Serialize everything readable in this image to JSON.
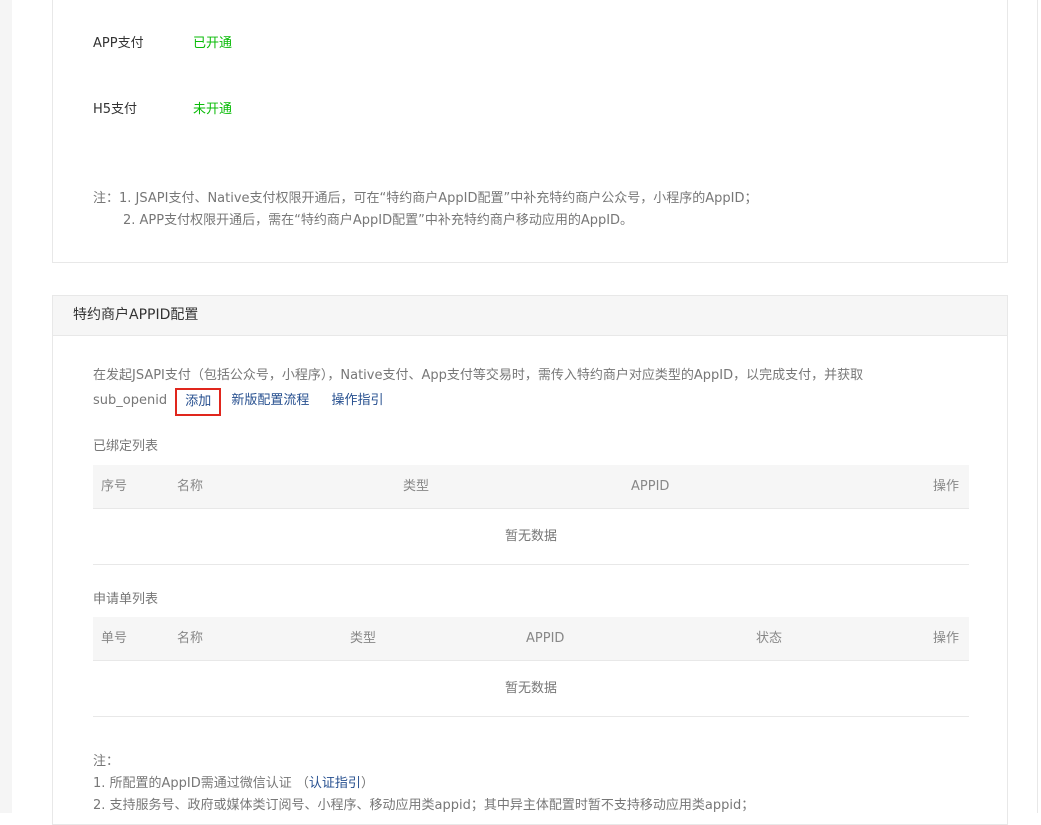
{
  "pay_methods": [
    {
      "label": "APP支付",
      "status": "已开通"
    },
    {
      "label": "H5支付",
      "status": "未开通"
    }
  ],
  "notes1": {
    "prefix": "注：",
    "line1": "1. JSAPI支付、Native支付权限开通后，可在“特约商户AppID配置”中补充特约商户公众号，小程序的AppID；",
    "line2": "2. APP支付权限开通后，需在“特约商户AppID配置”中补充特约商户移动应用的AppID。"
  },
  "appid_config": {
    "title": "特约商户APPID配置",
    "description_line1": "在发起JSAPI支付（包括公众号，小程序），Native支付、App支付等交易时，需传入特约商户对应类型的AppID，以完成支付，并获取",
    "description_line2": "sub_openid",
    "add_label": "添加",
    "flow_label": "新版配置流程",
    "guide_label": "操作指引"
  },
  "bound_list": {
    "title": "已绑定列表",
    "columns": [
      "序号",
      "名称",
      "类型",
      "APPID",
      "操作"
    ],
    "empty_text": "暂无数据"
  },
  "apply_list": {
    "title": "申请单列表",
    "columns": [
      "单号",
      "名称",
      "类型",
      "APPID",
      "状态",
      "操作"
    ],
    "empty_text": "暂无数据"
  },
  "notes2": {
    "prefix": "注：",
    "line1_text": "1. 所配置的AppID需通过微信认证 （",
    "line1_link": "认证指引",
    "line1_end": "）",
    "line2": "2. 支持服务号、政府或媒体类订阅号、小程序、移动应用类appid；其中异主体配置时暂不支持移动应用类appid；"
  }
}
